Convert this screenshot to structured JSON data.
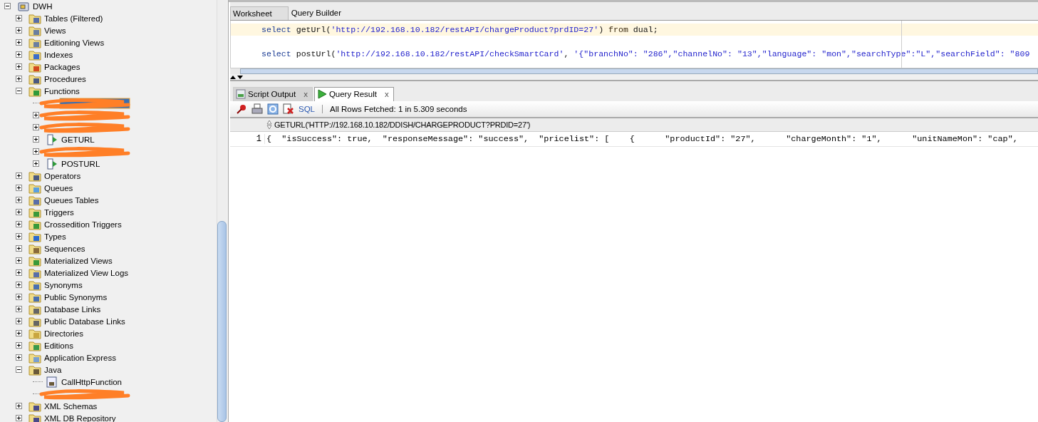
{
  "tree": {
    "label": "DWH",
    "expanded": true,
    "children": [
      {
        "label": "Tables (Filtered)",
        "expanded": false
      },
      {
        "label": "Views",
        "expanded": false
      },
      {
        "label": "Editioning Views",
        "expanded": false
      },
      {
        "label": "Indexes",
        "expanded": false
      },
      {
        "label": "Packages",
        "expanded": false
      },
      {
        "label": "Procedures",
        "expanded": false
      },
      {
        "label": "Functions",
        "expanded": true,
        "children": [
          {
            "kind": "redacted",
            "selected": true,
            "expandable": false
          },
          {
            "kind": "redacted",
            "selected": false,
            "expandable": true
          },
          {
            "kind": "redacted",
            "selected": false,
            "expandable": true
          },
          {
            "kind": "function",
            "label": "GETURL",
            "selected": false,
            "expandable": true
          },
          {
            "kind": "redacted",
            "selected": false,
            "expandable": true
          },
          {
            "kind": "function",
            "label": "POSTURL",
            "selected": false,
            "expandable": true
          }
        ]
      },
      {
        "label": "Operators",
        "expanded": false
      },
      {
        "label": "Queues",
        "expanded": false
      },
      {
        "label": "Queues Tables",
        "expanded": false
      },
      {
        "label": "Triggers",
        "expanded": false
      },
      {
        "label": "Crossedition Triggers",
        "expanded": false
      },
      {
        "label": "Types",
        "expanded": false
      },
      {
        "label": "Sequences",
        "expanded": false
      },
      {
        "label": "Materialized Views",
        "expanded": false
      },
      {
        "label": "Materialized View Logs",
        "expanded": false
      },
      {
        "label": "Synonyms",
        "expanded": false
      },
      {
        "label": "Public Synonyms",
        "expanded": false
      },
      {
        "label": "Database Links",
        "expanded": false
      },
      {
        "label": "Public Database Links",
        "expanded": false
      },
      {
        "label": "Directories",
        "expanded": false
      },
      {
        "label": "Editions",
        "expanded": false
      },
      {
        "label": "Application Express",
        "expanded": false
      },
      {
        "label": "Java",
        "expanded": true,
        "children": [
          {
            "kind": "java",
            "label": "CallHttpFunction",
            "selected": false,
            "expandable": false
          },
          {
            "kind": "redacted",
            "selected": false,
            "expandable": false
          }
        ]
      },
      {
        "label": "XML Schemas",
        "expanded": false
      },
      {
        "label": "XML DB Repository",
        "expanded": false
      }
    ]
  },
  "editor_tabs": [
    {
      "label": "Worksheet",
      "selected": true
    },
    {
      "label": "Query Builder",
      "selected": false
    }
  ],
  "code_lines": [
    {
      "current": true,
      "tokens": [
        {
          "kind": "keyword",
          "text": "select"
        },
        {
          "kind": "plain",
          "text": " getUrl("
        },
        {
          "kind": "string",
          "text": "'http://192.168.10.182/restAPI/chargeProduct?prdID=27'"
        },
        {
          "kind": "plain",
          "text": ") "
        },
        {
          "kind": "keyword2",
          "text": "from"
        },
        {
          "kind": "plain",
          "text": " dual;"
        }
      ]
    },
    {
      "current": false
    },
    {
      "current": false,
      "tokens": [
        {
          "kind": "keyword",
          "text": "select"
        },
        {
          "kind": "plain",
          "text": " postUrl("
        },
        {
          "kind": "string",
          "text": "'http://192.168.10.182/restAPI/checkSmartCard'"
        },
        {
          "kind": "plain",
          "text": ", "
        },
        {
          "kind": "string",
          "text": "'{\"branchNo\": \"286\",\"channelNo\": \"13\",\"language\": \"mon\",\"searchType\":\"L\",\"searchField\": \"809"
        }
      ]
    }
  ],
  "output_tabs": [
    {
      "label": "Script Output",
      "kind": "script",
      "selected": false,
      "close": "x"
    },
    {
      "label": "Query Result",
      "kind": "run",
      "selected": true,
      "close": "x"
    }
  ],
  "result_toolbar": {
    "sql_link": "SQL",
    "status": "All Rows Fetched: 1 in 5.309 seconds"
  },
  "result_grid": {
    "column": "GETURL('HTTP://192.168.10.182/DDISH/CHARGEPRODUCT?PRDID=27')",
    "rows": [
      {
        "number": "1",
        "value": "{  \"isSuccess\": true,  \"responseMessage\": \"success\",  \"pricelist\": [    {      \"productId\": \"27\",      \"chargeMonth\": \"1\",      \"unitNameMon\": \"cap\","
      }
    ]
  }
}
